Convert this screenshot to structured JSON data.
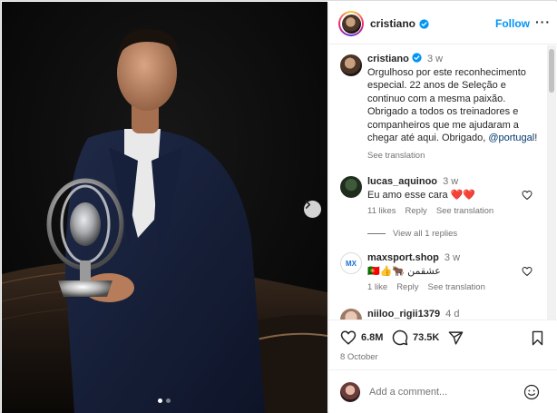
{
  "post": {
    "next_icon": "chevron-right-icon",
    "slides": {
      "count": 2,
      "active": 1
    }
  },
  "header": {
    "username": "cristiano",
    "verified_icon": "verified-badge-icon",
    "follow_label": "Follow",
    "more_icon": "more-options-icon"
  },
  "caption": {
    "username": "cristiano",
    "time": "3 w",
    "text": "Orgulhoso por este reconhecimento especial. 22 anos de Seleção e continuo com a mesma paixão. Obrigado a todos os treinadores e companheiros que me ajudaram a chegar até aqui. Obrigado, ",
    "mention": "@portugal",
    "suffix": "!",
    "see_translation": "See translation"
  },
  "comments": [
    {
      "username": "lucas_aquinoo",
      "time": "3 w",
      "text": "Eu amo esse cara ❤️❤️",
      "likes": "11 likes",
      "reply": "Reply",
      "see_translation": "See translation",
      "view_replies": "View all 1 replies"
    },
    {
      "username": "maxsport.shop",
      "time": "3 w",
      "text": "🇵🇹👍🐂 عشقمن",
      "likes": "1 like",
      "reply": "Reply",
      "see_translation": "See translation"
    },
    {
      "username": "niiloo_rigii1379",
      "time": "4 d"
    }
  ],
  "actions": {
    "like_icon": "heart-icon",
    "likes_count": "6.8M",
    "comment_icon": "comment-icon",
    "comments_count": "73.5K",
    "share_icon": "share-icon",
    "save_icon": "bookmark-icon",
    "date": "8 October"
  },
  "composer": {
    "placeholder": "Add a comment...",
    "emoji_icon": "emoji-icon"
  },
  "colors": {
    "accent": "#0095f6",
    "muted": "#737373",
    "heart_red": "#ed4956"
  }
}
